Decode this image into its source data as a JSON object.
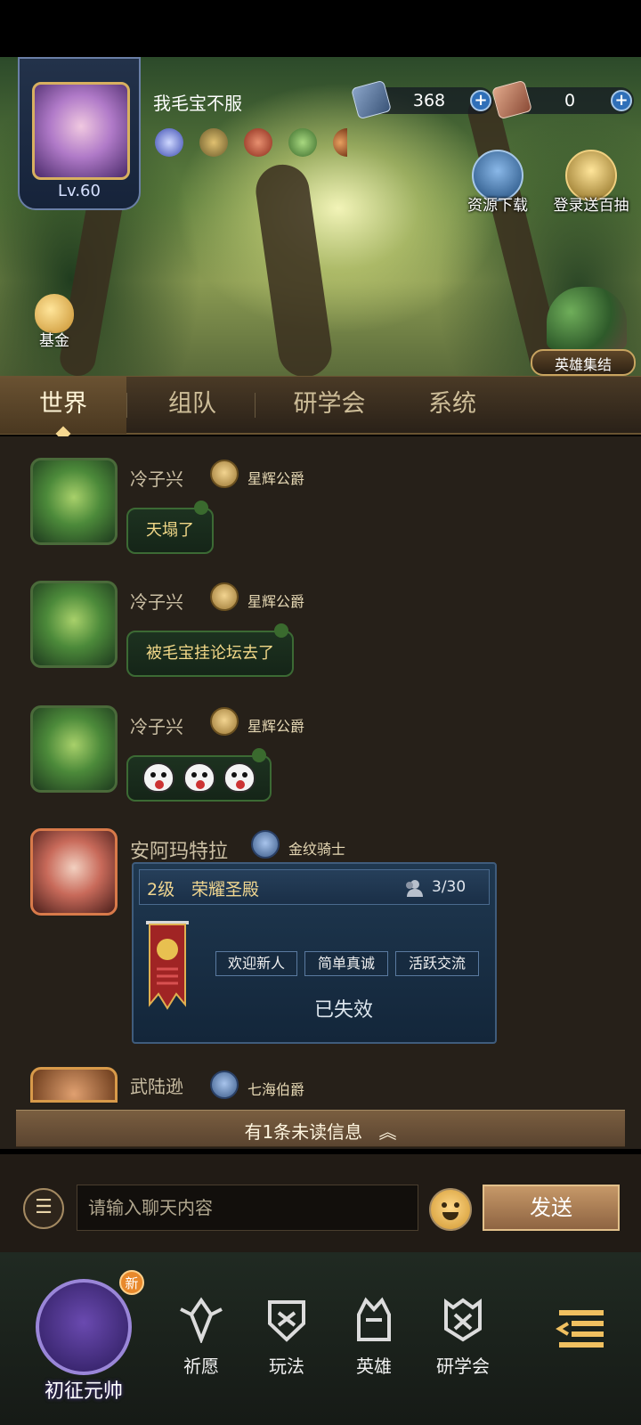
{
  "player": {
    "name": "我毛宝不服",
    "level": "Lv.60"
  },
  "currencies": [
    {
      "value": "368",
      "icon": "crystal-icon"
    },
    {
      "value": "0",
      "icon": "ticket-icon"
    }
  ],
  "top_buttons": {
    "resource_download": "资源下载",
    "login_reward": "登录送百抽",
    "fund": "基金",
    "hero_gather": "英雄集结"
  },
  "tabs": [
    "世界",
    "组队",
    "研学会",
    "系统"
  ],
  "active_tab": "世界",
  "messages": [
    {
      "name": "冷子兴",
      "title": "星辉公爵",
      "text": "天塌了"
    },
    {
      "name": "冷子兴",
      "title": "星辉公爵",
      "text": "被毛宝挂论坛去了"
    },
    {
      "name": "冷子兴",
      "title": "星辉公爵",
      "text": ""
    },
    {
      "name": "安阿玛特拉",
      "title": "金纹骑士"
    }
  ],
  "guild_card": {
    "level": "2级",
    "name": "荣耀圣殿",
    "members": "3/30",
    "tags": [
      "欢迎新人",
      "简单真诚",
      "活跃交流"
    ],
    "status": "已失效"
  },
  "partial_message": {
    "name": "武陆逊",
    "title": "七海伯爵"
  },
  "unread": "有1条未读信息",
  "input": {
    "placeholder": "请输入聊天内容",
    "send": "发送"
  },
  "bottom_nav": {
    "rank": "初征元帅",
    "rank_badge": "新",
    "items": [
      "祈愿",
      "玩法",
      "英雄",
      "研学会"
    ]
  }
}
